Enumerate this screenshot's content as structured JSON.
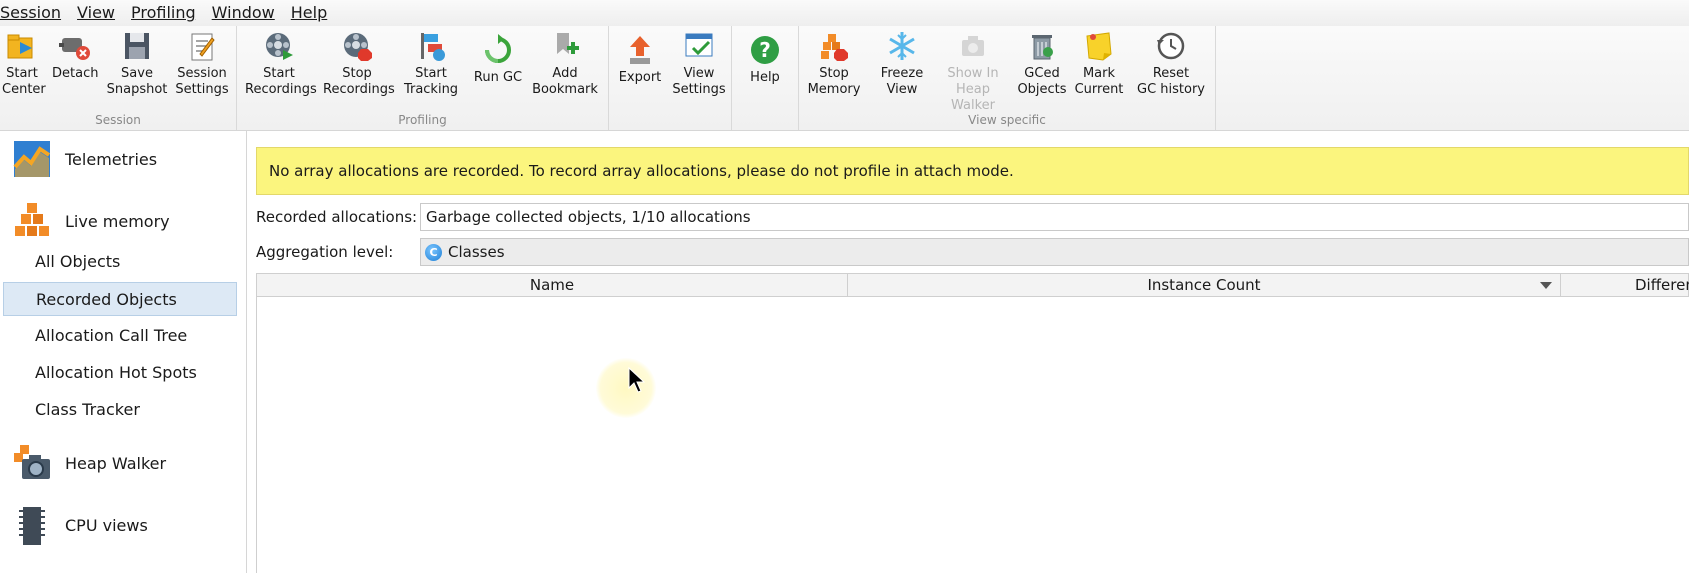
{
  "menu": [
    "Session",
    "View",
    "Profiling",
    "Window",
    "Help"
  ],
  "toolbar": {
    "groups": {
      "session": "Session",
      "profiling": "Profiling",
      "view_specific": "View specific"
    },
    "start_center": "Start\nCenter",
    "detach": "Detach",
    "save_snapshot": "Save\nSnapshot",
    "session_settings": "Session\nSettings",
    "start_recordings": "Start\nRecordings",
    "stop_recordings": "Stop\nRecordings",
    "start_tracking": "Start\nTracking",
    "run_gc": "Run GC",
    "add_bookmark": "Add\nBookmark",
    "export": "Export",
    "view_settings": "View\nSettings",
    "help": "Help",
    "stop_memory": "Stop\nMemory",
    "freeze_view": "Freeze\nView",
    "show_in_heap_walker": "Show In\nHeap Walker",
    "gced_objects": "GCed\nObjects",
    "mark_current": "Mark\nCurrent",
    "reset_gc_history": "Reset\nGC history"
  },
  "sidebar": {
    "telemetries": "Telemetries",
    "live_memory": "Live memory",
    "items": [
      "All Objects",
      "Recorded Objects",
      "Allocation Call Tree",
      "Allocation Hot Spots",
      "Class Tracker"
    ],
    "selected": "Recorded Objects",
    "heap_walker": "Heap Walker",
    "cpu_views": "CPU views"
  },
  "main": {
    "banner": "No array allocations are recorded. To record array allocations, please do not profile in attach mode.",
    "recorded_label": "Recorded allocations:",
    "recorded_value": "Garbage collected objects, 1/10 allocations",
    "aggregation_label": "Aggregation level:",
    "aggregation_value": "Classes",
    "aggregation_icon_letter": "C",
    "columns": [
      "Name",
      "Instance Count",
      "Difference"
    ]
  }
}
